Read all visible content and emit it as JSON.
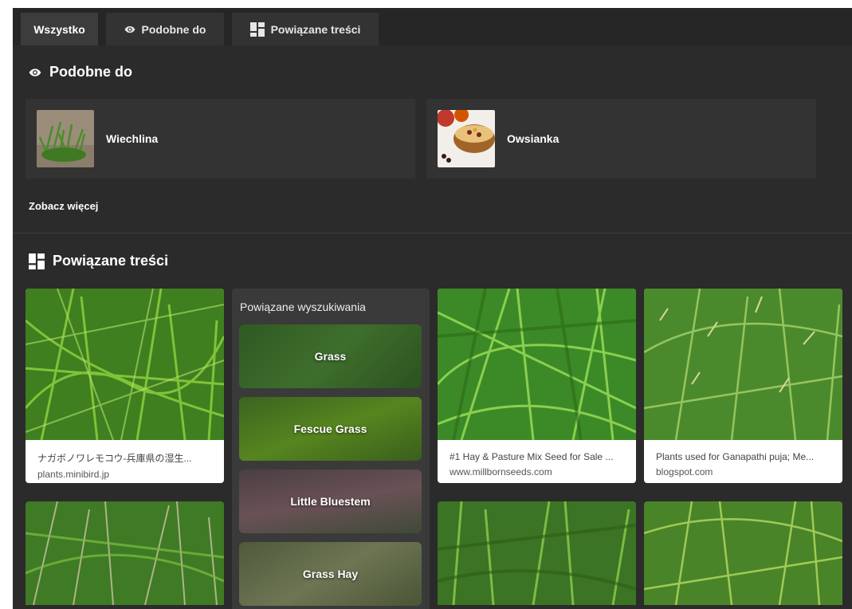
{
  "tabs": [
    {
      "label": "Wszystko",
      "icon": null,
      "active": true
    },
    {
      "label": "Podobne do",
      "icon": "eye-icon",
      "active": false
    },
    {
      "label": "Powiązane treści",
      "icon": "grid-icon",
      "active": false
    }
  ],
  "similar": {
    "title": "Podobne do",
    "items": [
      {
        "label": "Wiechlina"
      },
      {
        "label": "Owsianka"
      }
    ],
    "see_more": "Zobacz więcej"
  },
  "related_content": {
    "title": "Powiązane treści",
    "cards": [
      {
        "title": "ナガボノワレモコウ-兵庫県の湿生...",
        "source": "plants.minibird.jp"
      },
      {
        "title": "#1 Hay & Pasture Mix Seed for Sale ...",
        "source": "www.millbornseeds.com"
      },
      {
        "title": "Plants used for Ganapathi puja; Me...",
        "source": "blogspot.com"
      }
    ],
    "related_searches": {
      "title": "Powiązane wyszukiwania",
      "items": [
        {
          "label": "Grass"
        },
        {
          "label": "Fescue Grass"
        },
        {
          "label": "Little Bluestem"
        },
        {
          "label": "Grass Hay"
        }
      ]
    }
  },
  "colors": {
    "background": "#2b2b2b",
    "tab_bar": "#262626",
    "card": "#333333",
    "accent_text": "#ffffff"
  }
}
